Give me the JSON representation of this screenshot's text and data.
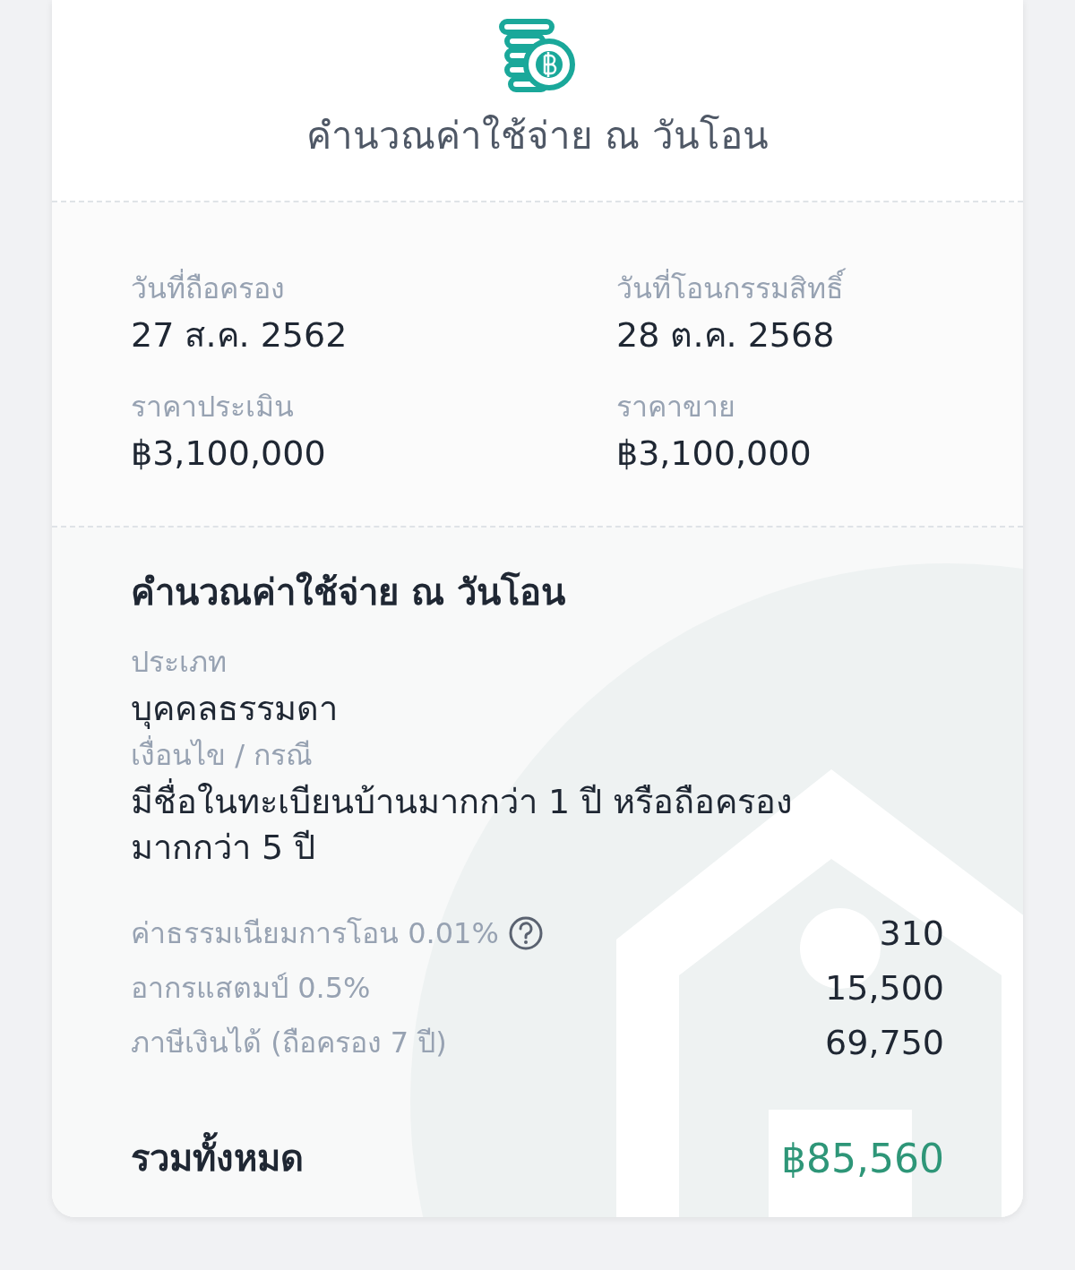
{
  "header": {
    "title": "คำนวณค่าใช้จ่าย ณ วันโอน"
  },
  "summary": [
    {
      "label": "วันที่ถือครอง",
      "value": "27 ส.ค. 2562"
    },
    {
      "label": "วันที่โอนกรรมสิทธิ์",
      "value": "28 ต.ค. 2568"
    },
    {
      "label": "ราคาประเมิน",
      "value": "฿3,100,000"
    },
    {
      "label": "ราคาขาย",
      "value": "฿3,100,000"
    }
  ],
  "calculation": {
    "title": "คำนวณค่าใช้จ่าย ณ วันโอน",
    "details": [
      {
        "label": "ประเภท",
        "value": "บุคคลธรรมดา"
      },
      {
        "label": "เงื่อนไข / กรณี",
        "value": "มีชื่อในทะเบียนบ้านมากกว่า 1 ปี หรือถือครองมากกว่า 5 ปี"
      }
    ],
    "fees": [
      {
        "label": "ค่าธรรมเนียมการโอน 0.01%",
        "value": "310",
        "help": true
      },
      {
        "label": "อากรแสตมป์ 0.5%",
        "value": "15,500",
        "help": false
      },
      {
        "label": "ภาษีเงินได้ (ถือครอง 7 ปี)",
        "value": "69,750",
        "help": false
      }
    ],
    "total": {
      "label": "รวมทั้งหมด",
      "value": "฿85,560"
    }
  }
}
